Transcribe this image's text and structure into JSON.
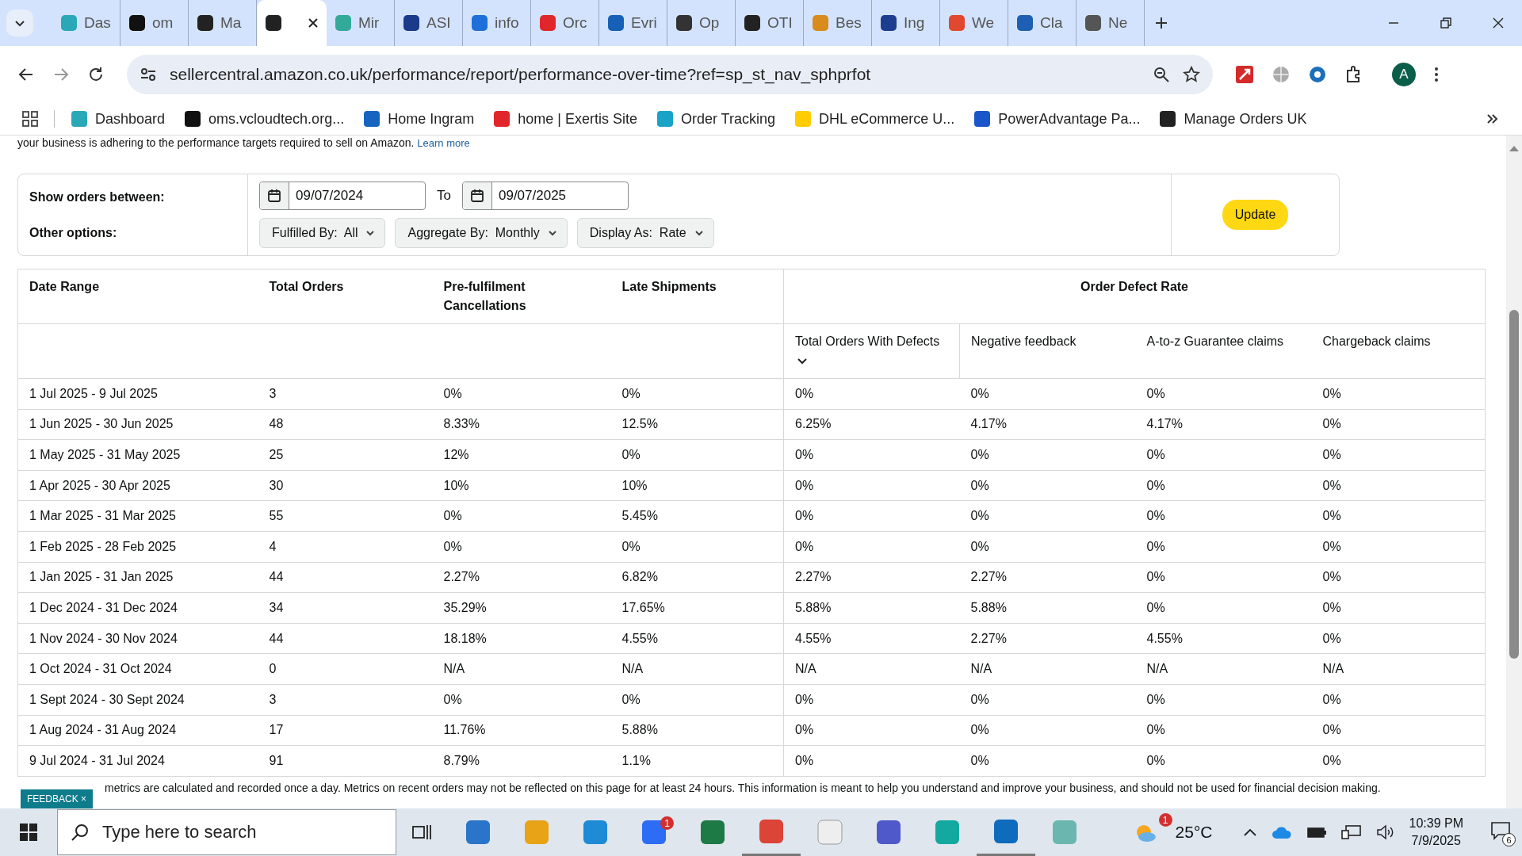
{
  "tabs": [
    {
      "label": "Das",
      "selected": false
    },
    {
      "label": "om",
      "selected": false
    },
    {
      "label": "Ma",
      "selected": false
    },
    {
      "selected": true
    },
    {
      "label": "Mir",
      "selected": false
    },
    {
      "label": "ASI",
      "selected": false
    },
    {
      "label": "info",
      "selected": false
    },
    {
      "label": "Orc",
      "selected": false
    },
    {
      "label": "Evri",
      "selected": false
    },
    {
      "label": "Op",
      "selected": false
    },
    {
      "label": "OTI",
      "selected": false
    },
    {
      "label": "Bes",
      "selected": false
    },
    {
      "label": "Ing",
      "selected": false
    },
    {
      "label": "We",
      "selected": false
    },
    {
      "label": "Cla",
      "selected": false
    },
    {
      "label": "Ne",
      "selected": false
    }
  ],
  "address": "sellercentral.amazon.co.uk/performance/report/performance-over-time?ref=sp_st_nav_sphprfot",
  "profile": "A",
  "bookmarks": [
    "Dashboard",
    "oms.vcloudtech.org...",
    "Home Ingram",
    "home | Exertis Site",
    "Order Tracking",
    "DHL eCommerce U...",
    "PowerAdvantage Pa...",
    "Manage Orders UK"
  ],
  "intro": {
    "text": "your business is adhering to the performance targets required to sell on Amazon.",
    "link": "Learn more"
  },
  "filters": {
    "show_label": "Show orders between:",
    "from": "09/07/2024",
    "to_label": "To",
    "to": "09/07/2025",
    "other_label": "Other options:",
    "dropdowns": [
      {
        "label": "Fulfilled By:",
        "value": "All"
      },
      {
        "label": "Aggregate By:",
        "value": "Monthly"
      },
      {
        "label": "Display As:",
        "value": "Rate"
      }
    ],
    "update": "Update"
  },
  "table": {
    "columns": [
      "Date Range",
      "Total Orders",
      "Pre-fulfilment Cancellations",
      "Late Shipments"
    ],
    "group": "Order Defect Rate",
    "subcolumns": [
      "Total Orders With Defects",
      "Negative feedback",
      "A-to-z Guarantee claims",
      "Chargeback claims"
    ],
    "rows": [
      [
        "1 Jul 2025 - 9 Jul 2025",
        "3",
        "0%",
        "0%",
        "0%",
        "0%",
        "0%",
        "0%"
      ],
      [
        "1 Jun 2025 - 30 Jun 2025",
        "48",
        "8.33%",
        "12.5%",
        "6.25%",
        "4.17%",
        "4.17%",
        "0%"
      ],
      [
        "1 May 2025 - 31 May 2025",
        "25",
        "12%",
        "0%",
        "0%",
        "0%",
        "0%",
        "0%"
      ],
      [
        "1 Apr 2025 - 30 Apr 2025",
        "30",
        "10%",
        "10%",
        "0%",
        "0%",
        "0%",
        "0%"
      ],
      [
        "1 Mar 2025 - 31 Mar 2025",
        "55",
        "0%",
        "5.45%",
        "0%",
        "0%",
        "0%",
        "0%"
      ],
      [
        "1 Feb 2025 - 28 Feb 2025",
        "4",
        "0%",
        "0%",
        "0%",
        "0%",
        "0%",
        "0%"
      ],
      [
        "1 Jan 2025 - 31 Jan 2025",
        "44",
        "2.27%",
        "6.82%",
        "2.27%",
        "2.27%",
        "0%",
        "0%"
      ],
      [
        "1 Dec 2024 - 31 Dec 2024",
        "34",
        "35.29%",
        "17.65%",
        "5.88%",
        "5.88%",
        "0%",
        "0%"
      ],
      [
        "1 Nov 2024 - 30 Nov 2024",
        "44",
        "18.18%",
        "4.55%",
        "4.55%",
        "2.27%",
        "4.55%",
        "0%"
      ],
      [
        "1 Oct 2024 - 31 Oct 2024",
        "0",
        "N/A",
        "N/A",
        "N/A",
        "N/A",
        "N/A",
        "N/A"
      ],
      [
        "1 Sept 2024 - 30 Sept 2024",
        "3",
        "0%",
        "0%",
        "0%",
        "0%",
        "0%",
        "0%"
      ],
      [
        "1 Aug 2024 - 31 Aug 2024",
        "17",
        "11.76%",
        "5.88%",
        "0%",
        "0%",
        "0%",
        "0%"
      ],
      [
        "9 Jul 2024 - 31 Jul 2024",
        "91",
        "8.79%",
        "1.1%",
        "0%",
        "0%",
        "0%",
        "0%"
      ]
    ]
  },
  "note": "metrics are calculated and recorded once a day. Metrics on recent orders may not be reflected on this page for at least 24 hours. This information is meant to help you understand and improve your business, and should not be used for financial decision making.",
  "feedback": "FEEDBACK",
  "feedback_close": "×",
  "taskbar": {
    "search_placeholder": "Type here to search",
    "zoom_badge": "1",
    "weather_badge": "1",
    "temperature": "25°C",
    "time": "10:39 PM",
    "date": "7/9/2025",
    "notifications": "6"
  }
}
